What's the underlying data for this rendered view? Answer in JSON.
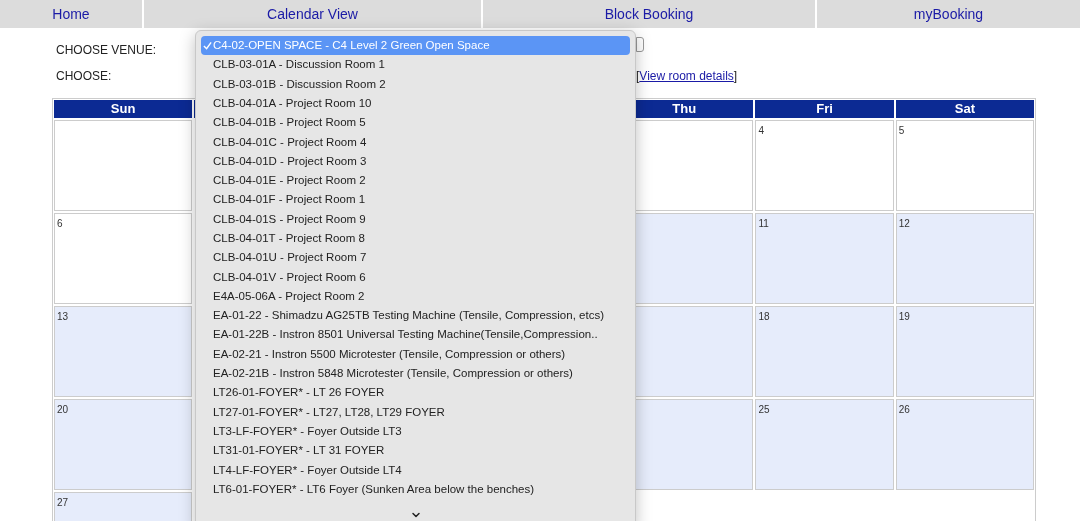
{
  "nav_tabs": [
    {
      "label": "Home"
    },
    {
      "label": "Calendar View"
    },
    {
      "label": "Block Booking"
    },
    {
      "label": "myBooking"
    }
  ],
  "venue_label": "CHOOSE VENUE:",
  "choose_label": "CHOOSE:",
  "view_details": {
    "open": "[",
    "link": "View room details",
    "close": "]"
  },
  "venue_options": [
    {
      "label": "C4-02-OPEN SPACE - C4 Level 2 Green Open Space",
      "selected": true
    },
    {
      "label": "CLB-03-01A - Discussion Room 1",
      "selected": false
    },
    {
      "label": "CLB-03-01B - Discussion Room 2",
      "selected": false
    },
    {
      "label": "CLB-04-01A - Project Room 10",
      "selected": false
    },
    {
      "label": "CLB-04-01B - Project Room 5",
      "selected": false
    },
    {
      "label": "CLB-04-01C - Project Room 4",
      "selected": false
    },
    {
      "label": "CLB-04-01D - Project Room 3",
      "selected": false
    },
    {
      "label": "CLB-04-01E - Project Room 2",
      "selected": false
    },
    {
      "label": "CLB-04-01F - Project Room 1",
      "selected": false
    },
    {
      "label": "CLB-04-01S - Project Room 9",
      "selected": false
    },
    {
      "label": "CLB-04-01T - Project Room 8",
      "selected": false
    },
    {
      "label": "CLB-04-01U - Project Room 7",
      "selected": false
    },
    {
      "label": "CLB-04-01V - Project Room 6",
      "selected": false
    },
    {
      "label": "E4A-05-06A - Project Room 2",
      "selected": false
    },
    {
      "label": "EA-01-22 - Shimadzu AG25TB Testing Machine (Tensile, Compression, etcs)",
      "selected": false
    },
    {
      "label": "EA-01-22B - Instron 8501 Universal Testing Machine(Tensile,Compression..",
      "selected": false
    },
    {
      "label": "EA-02-21 - Instron 5500 Microtester (Tensile, Compression or others)",
      "selected": false
    },
    {
      "label": "EA-02-21B - Instron 5848 Microtester (Tensile, Compression or others)",
      "selected": false
    },
    {
      "label": "LT26-01-FOYER* - LT 26 FOYER",
      "selected": false
    },
    {
      "label": "LT27-01-FOYER* - LT27, LT28, LT29 FOYER",
      "selected": false
    },
    {
      "label": "LT3-LF-FOYER* - Foyer Outside LT3",
      "selected": false
    },
    {
      "label": "LT31-01-FOYER* - LT 31 FOYER",
      "selected": false
    },
    {
      "label": "LT4-LF-FOYER* - Foyer Outside LT4",
      "selected": false
    },
    {
      "label": "LT6-01-FOYER* - LT6 Foyer (Sunken Area below the benches)",
      "selected": false
    }
  ],
  "calendar": {
    "columns": [
      {
        "header": "Sun",
        "cells": [
          {
            "shaded": false
          },
          {
            "date": "6",
            "shaded": false
          },
          {
            "date": "13",
            "shaded": true
          },
          {
            "date": "20",
            "shaded": true
          },
          {
            "date": "27",
            "shaded": true
          }
        ]
      },
      {
        "header": "Thu",
        "cells": [
          {
            "shaded": false
          },
          {
            "shaded": true
          },
          {
            "shaded": true
          },
          {
            "shaded": true
          }
        ]
      },
      {
        "header": "Fri",
        "cells": [
          {
            "date": "4",
            "shaded": false
          },
          {
            "date": "11",
            "shaded": true
          },
          {
            "date": "18",
            "shaded": true
          },
          {
            "date": "25",
            "shaded": true
          }
        ]
      },
      {
        "header": "Sat",
        "cells": [
          {
            "date": "5",
            "shaded": false
          },
          {
            "date": "12",
            "shaded": true
          },
          {
            "date": "19",
            "shaded": true
          },
          {
            "date": "26",
            "shaded": true
          }
        ]
      }
    ]
  }
}
